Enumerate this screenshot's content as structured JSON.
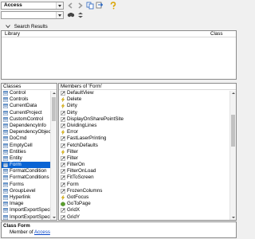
{
  "toolbar": {
    "library_select": "Access",
    "search_input": "",
    "icons": [
      "back-icon",
      "forward-icon",
      "copy-icon",
      "view-definition-icon",
      "help-icon",
      "search-icon",
      "collapse-icon"
    ]
  },
  "search_results": {
    "title": "Search Results",
    "columns": [
      "Library",
      "Class"
    ]
  },
  "classes": {
    "header": "Classes",
    "selected": "Form",
    "items": [
      "Control",
      "Controls",
      "CurrentData",
      "CurrentProject",
      "CustomControl",
      "DependencyInfo",
      "DependencyObjects",
      "DoCmd",
      "EmptyCell",
      "Entities",
      "Entity",
      "Form",
      "FormatCondition",
      "FormatConditions",
      "Forms",
      "GroupLevel",
      "Hyperlink",
      "Image",
      "ImportExportSpecific",
      "ImportExportSpecific"
    ]
  },
  "members": {
    "header": "Members of 'Form'",
    "items": [
      {
        "name": "DefaultView",
        "kind": "property"
      },
      {
        "name": "Delete",
        "kind": "event"
      },
      {
        "name": "Dirty",
        "kind": "event"
      },
      {
        "name": "Dirty",
        "kind": "property"
      },
      {
        "name": "DisplayOnSharePointSite",
        "kind": "property"
      },
      {
        "name": "DividingLines",
        "kind": "property"
      },
      {
        "name": "Error",
        "kind": "event"
      },
      {
        "name": "FastLaserPrinting",
        "kind": "property"
      },
      {
        "name": "FetchDefaults",
        "kind": "property"
      },
      {
        "name": "Filter",
        "kind": "event"
      },
      {
        "name": "Filter",
        "kind": "property"
      },
      {
        "name": "FilterOn",
        "kind": "property"
      },
      {
        "name": "FilterOnLoad",
        "kind": "property"
      },
      {
        "name": "FitToScreen",
        "kind": "property"
      },
      {
        "name": "Form",
        "kind": "property"
      },
      {
        "name": "FrozenColumns",
        "kind": "property"
      },
      {
        "name": "GotFocus",
        "kind": "event"
      },
      {
        "name": "GoToPage",
        "kind": "method"
      },
      {
        "name": "GridX",
        "kind": "property"
      },
      {
        "name": "GridY",
        "kind": "property"
      }
    ]
  },
  "details": {
    "class_label": "Class",
    "class_name": "Form",
    "member_of_label": "Member of",
    "member_of_link": "Access"
  },
  "colors": {
    "selection": "#0a64d4",
    "link": "#0645c8",
    "event_icon": "#f0c000",
    "method_icon": "#5aa02c"
  }
}
